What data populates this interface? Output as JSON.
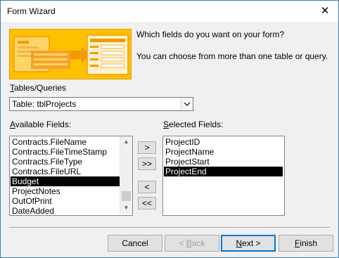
{
  "window": {
    "title": "Form Wizard",
    "close_glyph": "✕"
  },
  "intro": {
    "question": "Which fields do you want on your form?",
    "hint": "You can choose from more than one table or query."
  },
  "tables_queries": {
    "label_mnemonic": "T",
    "label_rest": "ables/Queries",
    "selected": "Table: tblProjects",
    "dropdown_icon": "chevron-down-icon"
  },
  "available_fields": {
    "label_mnemonic": "A",
    "label_rest": "vailable Fields:",
    "items": [
      "Contracts.FileName",
      "Contracts.FileTimeStamp",
      "Contracts.FileType",
      "Contracts.FileURL",
      "Budget",
      "ProjectNotes",
      "OutOfPrint",
      "DateAdded"
    ],
    "selected_index": 4,
    "scroll_position_fraction": 0.8
  },
  "selected_fields": {
    "label_mnemonic": "S",
    "label_rest": "elected Fields:",
    "items": [
      "ProjectID",
      "ProjectName",
      "ProjectStart",
      "ProjectEnd"
    ],
    "selected_index": 3
  },
  "move_buttons": {
    "add": ">",
    "add_all": ">>",
    "remove": "<",
    "remove_all": "<<"
  },
  "footer": {
    "cancel": "Cancel",
    "back_prefix": "< ",
    "back_mnemonic": "B",
    "back_rest": "ack",
    "next_mnemonic": "N",
    "next_rest": "ext >",
    "finish_mnemonic": "F",
    "finish_rest": "inish"
  },
  "colors": {
    "accent": "#0078d7",
    "banner": "#ffc000",
    "banner_detail": "#f29a00",
    "selection": "#000000"
  }
}
